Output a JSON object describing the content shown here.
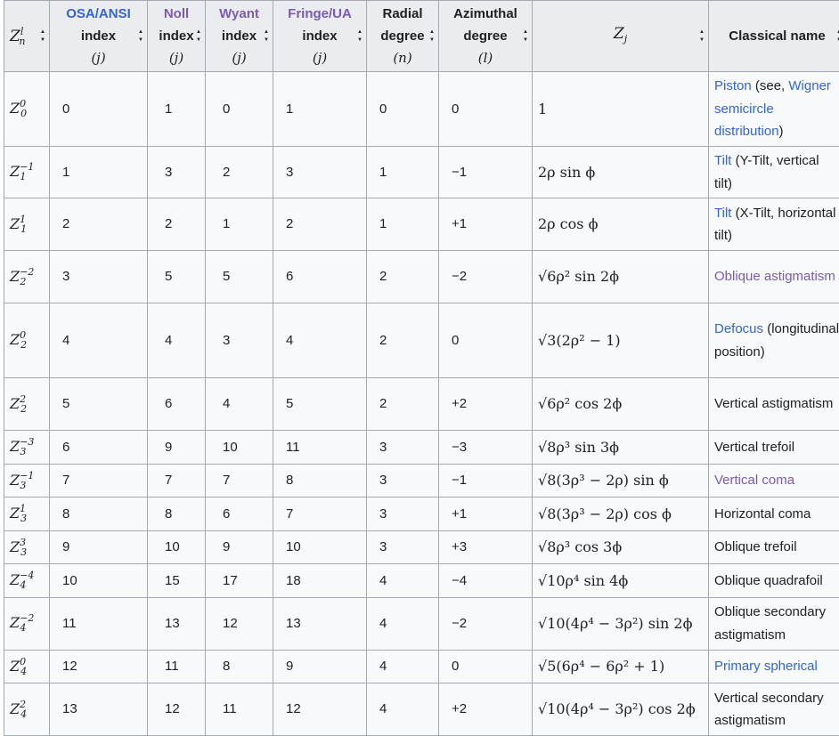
{
  "headers": [
    {
      "lines": [
        "Z",
        "n",
        "l"
      ],
      "kind": "zsym"
    },
    {
      "lines": [
        "OSA/ANSI",
        "index",
        "(j)"
      ],
      "link": "link"
    },
    {
      "lines": [
        "Noll",
        "index",
        "(j)"
      ],
      "link": "visited"
    },
    {
      "lines": [
        "Wyant",
        "index",
        "(j)"
      ],
      "link": "visited"
    },
    {
      "lines": [
        "Fringe/UA",
        "index",
        "(j)"
      ],
      "link": "visited"
    },
    {
      "lines": [
        "Radial",
        "degree",
        "(n)"
      ],
      "link": "plain"
    },
    {
      "lines": [
        "Azimuthal",
        "degree",
        "(l)"
      ],
      "link": "plain"
    },
    {
      "lines": [
        "Z",
        "j"
      ],
      "kind": "zj"
    },
    {
      "lines": [
        "Classical name"
      ],
      "link": "plain"
    }
  ],
  "rows": [
    {
      "z": [
        "Z",
        "0",
        "0"
      ],
      "osa": "0",
      "noll": "1",
      "wyant": "0",
      "fringe": "1",
      "n": "0",
      "l": "0",
      "formula": "1",
      "name": [
        [
          "Piston",
          "link"
        ],
        [
          " (see, ",
          "plain"
        ],
        [
          "Wigner semicircle distribution",
          "link"
        ],
        [
          ")",
          "plain"
        ]
      ],
      "h": 84
    },
    {
      "z": [
        "Z",
        "1",
        "−1"
      ],
      "osa": "1",
      "noll": "3",
      "wyant": "2",
      "fringe": "3",
      "n": "1",
      "l": "−1",
      "formula": "2ρ sin ϕ",
      "name": [
        [
          "Tilt",
          "link"
        ],
        [
          " (Y-Tilt, vertical tilt)",
          "plain"
        ]
      ],
      "h": 58
    },
    {
      "z": [
        "Z",
        "1",
        "1"
      ],
      "osa": "2",
      "noll": "2",
      "wyant": "1",
      "fringe": "2",
      "n": "1",
      "l": "+1",
      "formula": "2ρ cos ϕ",
      "name": [
        [
          "Tilt",
          "link"
        ],
        [
          " (X-Tilt, horizontal tilt)",
          "plain"
        ]
      ],
      "h": 59
    },
    {
      "z": [
        "Z",
        "2",
        "−2"
      ],
      "osa": "3",
      "noll": "5",
      "wyant": "5",
      "fringe": "6",
      "n": "2",
      "l": "−2",
      "formula": "√6ρ² sin 2ϕ",
      "name": [
        [
          "Oblique astigmatism",
          "visited"
        ]
      ],
      "h": 59
    },
    {
      "z": [
        "Z",
        "2",
        "0"
      ],
      "osa": "4",
      "noll": "4",
      "wyant": "3",
      "fringe": "4",
      "n": "2",
      "l": "0",
      "formula": "√3(2ρ² − 1)",
      "name": [
        [
          "Defocus",
          "link"
        ],
        [
          " (longitudinal position)",
          "plain"
        ]
      ],
      "h": 84
    },
    {
      "z": [
        "Z",
        "2",
        "2"
      ],
      "osa": "5",
      "noll": "6",
      "wyant": "4",
      "fringe": "5",
      "n": "2",
      "l": "+2",
      "formula": "√6ρ² cos 2ϕ",
      "name": [
        [
          "Vertical astigmatism",
          "plain"
        ]
      ],
      "h": 59
    },
    {
      "z": [
        "Z",
        "3",
        "−3"
      ],
      "osa": "6",
      "noll": "9",
      "wyant": "10",
      "fringe": "11",
      "n": "3",
      "l": "−3",
      "formula": "√8ρ³ sin 3ϕ",
      "name": [
        [
          "Vertical trefoil",
          "plain"
        ]
      ],
      "h": 35
    },
    {
      "z": [
        "Z",
        "3",
        "−1"
      ],
      "osa": "7",
      "noll": "7",
      "wyant": "7",
      "fringe": "8",
      "n": "3",
      "l": "−1",
      "formula": "√8(3ρ³ − 2ρ) sin ϕ",
      "name": [
        [
          "Vertical coma",
          "visited"
        ]
      ],
      "h": 34
    },
    {
      "z": [
        "Z",
        "3",
        "1"
      ],
      "osa": "8",
      "noll": "8",
      "wyant": "6",
      "fringe": "7",
      "n": "3",
      "l": "+1",
      "formula": "√8(3ρ³ − 2ρ) cos ϕ",
      "name": [
        [
          "Horizontal coma",
          "plain"
        ]
      ],
      "h": 35
    },
    {
      "z": [
        "Z",
        "3",
        "3"
      ],
      "osa": "9",
      "noll": "10",
      "wyant": "9",
      "fringe": "10",
      "n": "3",
      "l": "+3",
      "formula": "√8ρ³ cos 3ϕ",
      "name": [
        [
          "Oblique trefoil",
          "plain"
        ]
      ],
      "h": 34
    },
    {
      "z": [
        "Z",
        "4",
        "−4"
      ],
      "osa": "10",
      "noll": "15",
      "wyant": "17",
      "fringe": "18",
      "n": "4",
      "l": "−4",
      "formula": "√10ρ⁴ sin 4ϕ",
      "name": [
        [
          "Oblique quadrafoil",
          "plain"
        ]
      ],
      "h": 35
    },
    {
      "z": [
        "Z",
        "4",
        "−2"
      ],
      "osa": "11",
      "noll": "13",
      "wyant": "12",
      "fringe": "13",
      "n": "4",
      "l": "−2",
      "formula": "√10(4ρ⁴ − 3ρ²) sin 2ϕ",
      "name": [
        [
          "Oblique secondary astigmatism",
          "plain"
        ]
      ],
      "h": 59
    },
    {
      "z": [
        "Z",
        "4",
        "0"
      ],
      "osa": "12",
      "noll": "11",
      "wyant": "8",
      "fringe": "9",
      "n": "4",
      "l": "0",
      "formula": "√5(6ρ⁴ − 6ρ² + 1)",
      "name": [
        [
          "Primary spherical",
          "link"
        ]
      ],
      "h": 34
    },
    {
      "z": [
        "Z",
        "4",
        "2"
      ],
      "osa": "13",
      "noll": "12",
      "wyant": "11",
      "fringe": "12",
      "n": "4",
      "l": "+2",
      "formula": "√10(4ρ⁴ − 3ρ²) cos 2ϕ",
      "name": [
        [
          "Vertical secondary astigmatism",
          "plain"
        ]
      ],
      "h": 59
    }
  ]
}
